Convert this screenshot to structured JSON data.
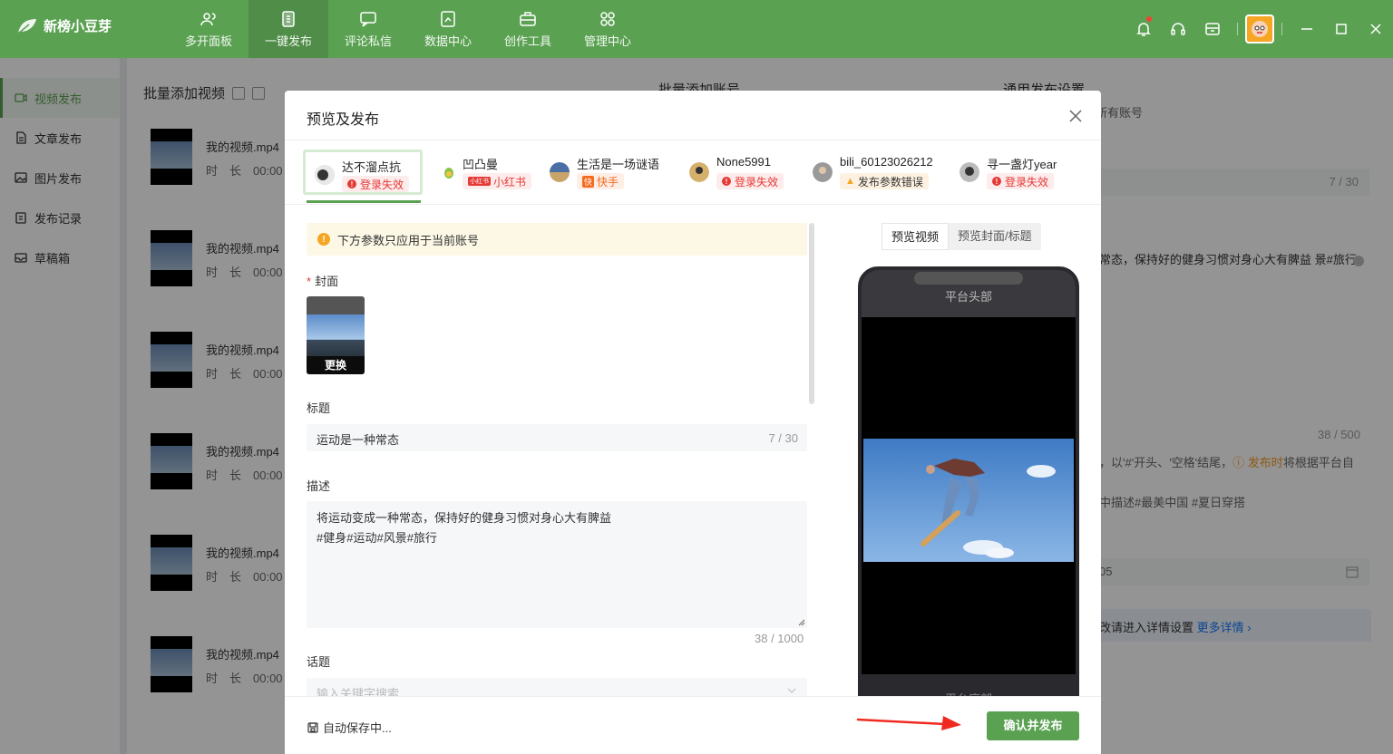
{
  "app": {
    "name": "新榜小豆芽",
    "brand_color": "#5aa152"
  },
  "nav": [
    {
      "label": "多开面板",
      "icon": "users-icon"
    },
    {
      "label": "一键发布",
      "icon": "publish-icon",
      "active": true
    },
    {
      "label": "评论私信",
      "icon": "message-icon"
    },
    {
      "label": "数据中心",
      "icon": "data-icon"
    },
    {
      "label": "创作工具",
      "icon": "toolbox-icon"
    },
    {
      "label": "管理中心",
      "icon": "grid-icon"
    }
  ],
  "sidebar": [
    {
      "label": "视频发布",
      "active": true
    },
    {
      "label": "文章发布"
    },
    {
      "label": "图片发布"
    },
    {
      "label": "发布记录"
    },
    {
      "label": "草稿箱"
    }
  ],
  "background": {
    "batch_video_title": "批量添加视频",
    "batch_account_title": "批量添加账号",
    "general_settings_title": "通用发布设置",
    "general_settings_sub": "改将会应用于所有账号",
    "title_count": "7 / 30",
    "desc_preview": "常态，保持好的健身习惯对身心大有脾益 景#旅行",
    "desc_count": "38 / 500",
    "tip_prefix": "，以'#'开头、'空格'结尾，",
    "tip_highlight": "发布时",
    "tip_suffix": "将根据平台自",
    "tag_examples": "中描述#最美中国 #夏日穿搭",
    "date_fragment": "05",
    "more_text": "改请进入详情设置",
    "more_link": "更多详情",
    "videos": [
      {
        "name": "我的视频.mp4",
        "duration": "时　长　00:00"
      },
      {
        "name": "我的视频.mp4",
        "duration": "时　长　00:00"
      },
      {
        "name": "我的视频.mp4",
        "duration": "时　长　00:00"
      },
      {
        "name": "我的视频.mp4",
        "duration": "时　长　00:00"
      },
      {
        "name": "我的视频.mp4",
        "duration": "时　长　00:00"
      },
      {
        "name": "我的视频.mp4",
        "duration": "时　长　00:00"
      }
    ]
  },
  "modal": {
    "title": "预览及发布",
    "accounts": [
      {
        "name": "达不溜点抗",
        "status": "登录失效",
        "status_type": "err",
        "selected": true
      },
      {
        "name": "凹凸曼",
        "status": "小红书",
        "status_type": "xhs"
      },
      {
        "name": "生活是一场谜语",
        "status": "快手",
        "status_type": "ks"
      },
      {
        "name": "None5991",
        "status": "登录失效",
        "status_type": "err"
      },
      {
        "name": "bili_60123026212",
        "status": "发布参数错误",
        "status_type": "warn"
      },
      {
        "name": "寻一盏灯year",
        "status": "登录失效",
        "status_type": "err"
      }
    ],
    "notice": "下方参数只应用于当前账号",
    "cover_label": "封面",
    "cover_change": "更换",
    "title_label": "标题",
    "title_value": "运动是一种常态",
    "title_count": "7 / 30",
    "desc_label": "描述",
    "desc_line1": "将运动变成一种常态，保持好的健身习惯对身心大有脾益",
    "desc_line2": "#健身#运动#风景#旅行",
    "desc_count": "38 / 1000",
    "topic_label": "话题",
    "topic_placeholder": "输入关键字搜索",
    "preview_tabs": [
      "预览视频",
      "预览封面/标题"
    ],
    "phone_header": "平台头部",
    "phone_footer": "平台底部",
    "autosave": "自动保存中...",
    "confirm": "确认并发布"
  }
}
